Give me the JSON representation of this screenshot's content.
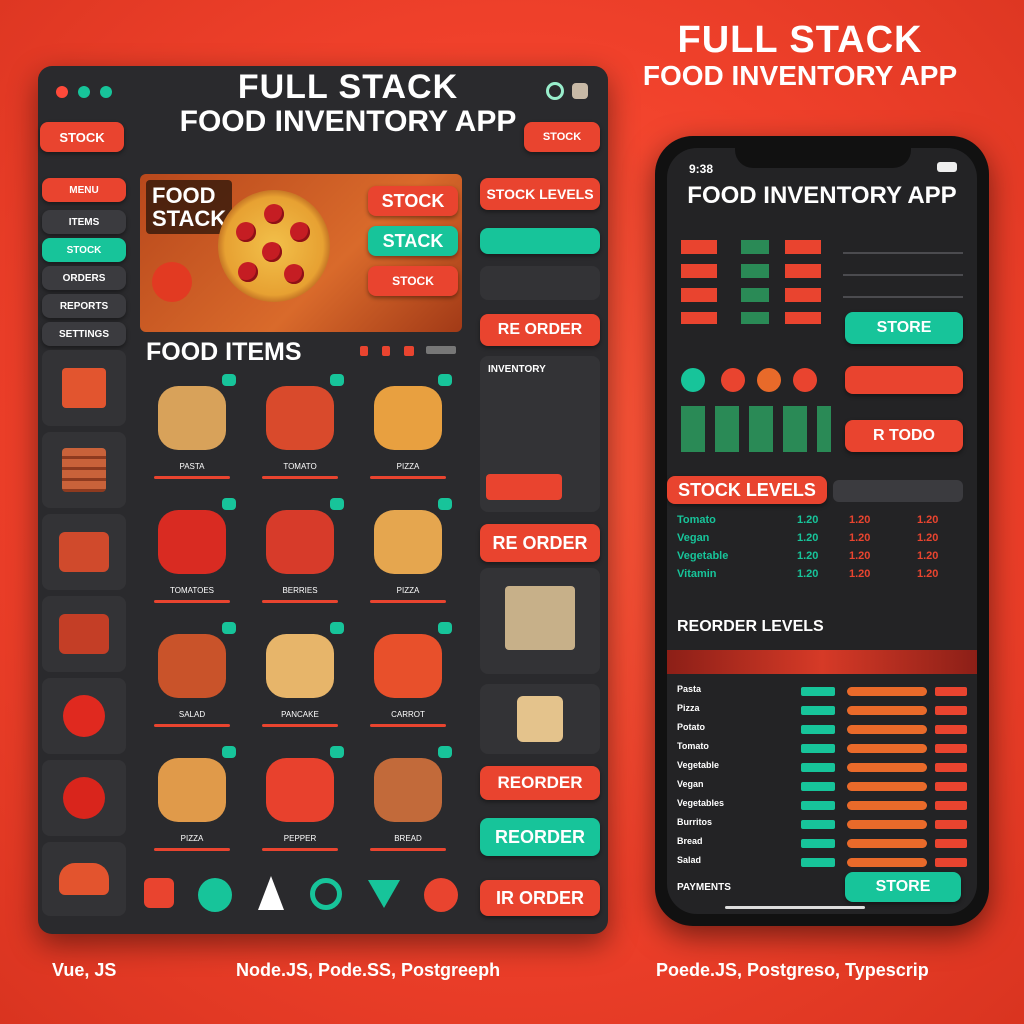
{
  "header": {
    "title_line1": "FULL STACK",
    "title_line2": "FOOD INVENTORY APP"
  },
  "desktop": {
    "title_line1": "FULL STACK",
    "title_line2": "FOOD INVENTORY APP",
    "top_left_button": "STOCK",
    "top_right_button": "STOCK",
    "hero_label_line1": "FOOD",
    "hero_label_line2": "STACK",
    "hero_buttons": [
      "STOCK",
      "STACK",
      "STOCK"
    ],
    "food_items_title": "FOOD ITEMS",
    "right_buttons": {
      "stock_levels": "STOCK LEVELS",
      "reorder_1": "RE ORDER",
      "inventory_title": "INVENTORY",
      "reorder_2": "RE ORDER",
      "reorder_3": "REORDER",
      "reorder_4": "REORDER",
      "reorder_5": "IR ORDER"
    },
    "sidebar_items": [
      "MENU",
      "ITEMS",
      "STOCK",
      "ORDERS",
      "REPORTS",
      "SETTINGS"
    ],
    "food_cards": [
      {
        "label": "PASTA",
        "icon": "pasta-icon"
      },
      {
        "label": "TOMATO",
        "icon": "tomato-icon"
      },
      {
        "label": "PIZZA",
        "icon": "pizza-icon"
      },
      {
        "label": "TOMATOES",
        "icon": "tomatoes-icon"
      },
      {
        "label": "BERRIES",
        "icon": "berries-icon"
      },
      {
        "label": "PIZZA",
        "icon": "pizza-icon"
      },
      {
        "label": "SALAD",
        "icon": "salad-icon"
      },
      {
        "label": "PANCAKE",
        "icon": "pancake-icon"
      },
      {
        "label": "CARROT",
        "icon": "carrot-icon"
      },
      {
        "label": "PIZZA",
        "icon": "pizza-icon"
      },
      {
        "label": "PEPPER",
        "icon": "pepper-icon"
      },
      {
        "label": "BREAD",
        "icon": "bread-icon"
      }
    ]
  },
  "phone": {
    "title": "FOOD INVENTORY APP",
    "status_left": "9:38",
    "store_button": "STORE",
    "reorder_button": "R TODO",
    "stock_levels_label": "STOCK LEVELS",
    "stock_rows": [
      {
        "name": "Tomato",
        "a": "1.20",
        "b": "1.20",
        "c": "1.20"
      },
      {
        "name": "Vegan",
        "a": "1.20",
        "b": "1.20",
        "c": "1.20"
      },
      {
        "name": "Vegetable",
        "a": "1.20",
        "b": "1.20",
        "c": "1.20"
      },
      {
        "name": "Vitamin",
        "a": "1.20",
        "b": "1.20",
        "c": "1.20"
      }
    ],
    "reorder_levels_label": "REORDER LEVELS",
    "reorder_rows": [
      "Pasta",
      "Pizza",
      "Potato",
      "Tomato",
      "Vegetable",
      "Vegan",
      "Vegetables",
      "Burritos",
      "Bread",
      "Salad"
    ],
    "bottom_button": "STORE",
    "bottom_left": "PAYMENTS"
  },
  "footer": {
    "left": "Vue, JS",
    "middle": "Node.JS, Pode.SS, Postgreeph",
    "right": "Poede.JS, Postgreso, Typescrip"
  },
  "colors": {
    "accent": "#f0412b",
    "teal": "#17c49a",
    "panel": "#2a2a2d"
  }
}
